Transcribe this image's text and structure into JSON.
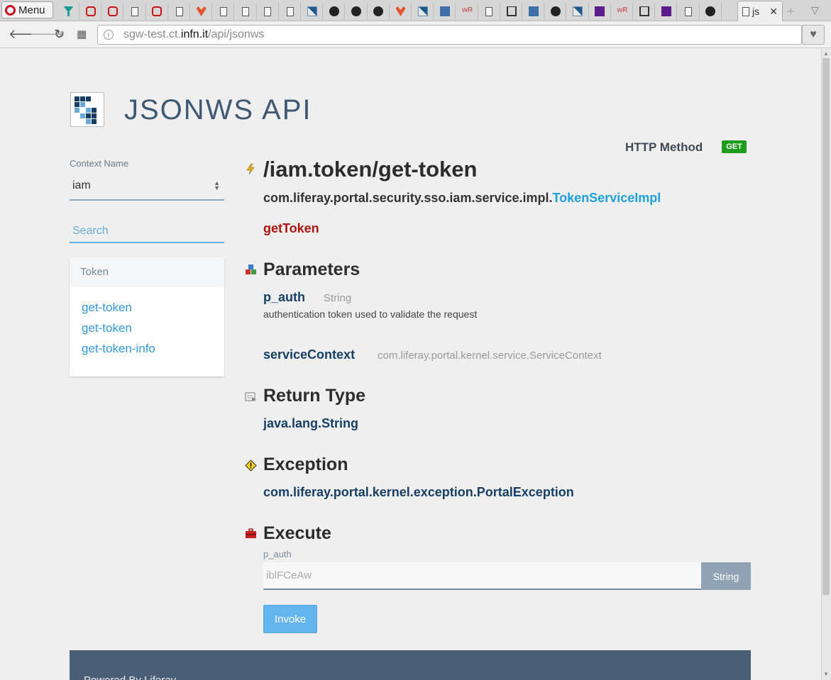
{
  "browser": {
    "menu_label": "Menu",
    "active_tab_title": "js",
    "url_host_prefix": "sgw-test.ct.",
    "url_host": "infn.it",
    "url_path": "/api/jsonws"
  },
  "favicons": [
    "teal",
    "red",
    "red",
    "doc",
    "pdf",
    "doc",
    "fox",
    "ogf",
    "doc",
    "doc",
    "doc",
    "chk",
    "gh",
    "gh",
    "gh",
    "orange",
    "chk",
    "blue",
    "wr",
    "link",
    "book",
    "blue",
    "gh",
    "chk",
    "circle",
    "wr",
    "book",
    "yahoo",
    "doc",
    "gh"
  ],
  "header": {
    "title": "JSONWS API"
  },
  "sidebar": {
    "context_label": "Context Name",
    "context_value": "iam",
    "search_placeholder": "Search",
    "section_title": "Token",
    "links": [
      "get-token",
      "get-token",
      "get-token-info"
    ]
  },
  "service": {
    "http_method_label": "HTTP Method",
    "http_method": "GET",
    "endpoint": "/iam.token/get-token",
    "class_package": "com.liferay.portal.security.sso.iam.service.impl.",
    "class_name": "TokenServiceImpl",
    "method": "getToken",
    "parameters_heading": "Parameters",
    "params": [
      {
        "name": "p_auth",
        "type": "String",
        "description": "authentication token used to validate the request"
      },
      {
        "name": "serviceContext",
        "type": "com.liferay.portal.kernel.service.ServiceContext"
      }
    ],
    "return_heading": "Return Type",
    "return_type": "java.lang.String",
    "exception_heading": "Exception",
    "exception_type": "com.liferay.portal.kernel.exception.PortalException"
  },
  "execute": {
    "heading": "Execute",
    "field_label": "p_auth",
    "field_placeholder": "iblFCeAw",
    "field_type": "String",
    "invoke_label": "Invoke"
  },
  "footer": {
    "text": "Powered By Liferay"
  }
}
